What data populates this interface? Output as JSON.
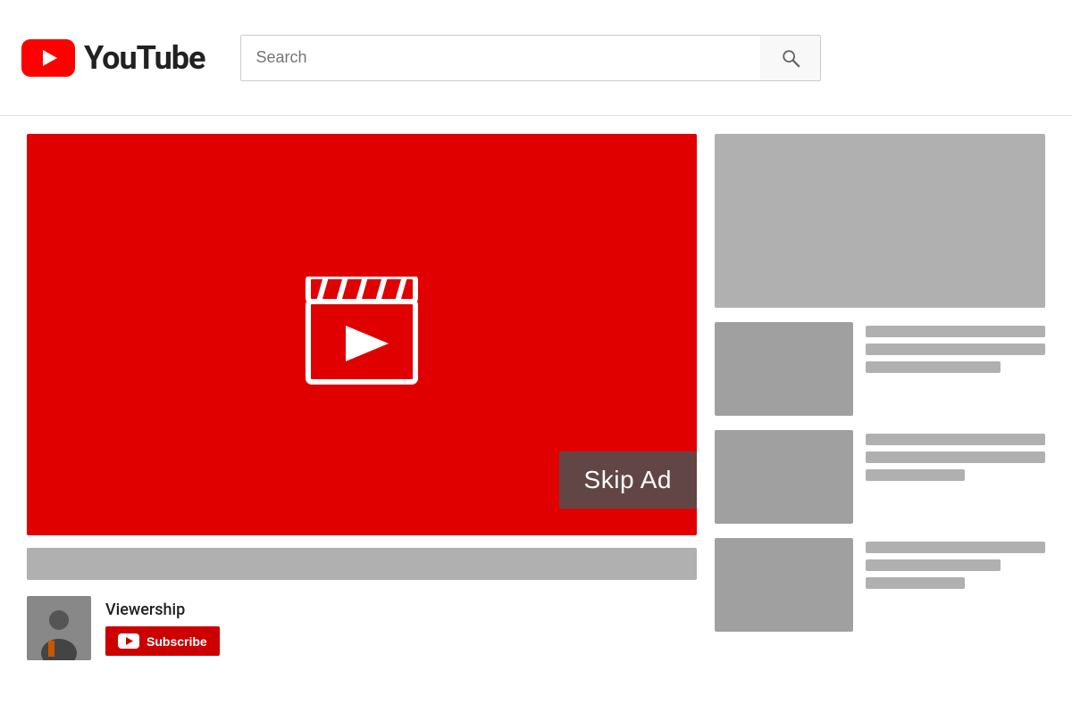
{
  "header": {
    "logo_text": "YouTube",
    "search_placeholder": "Search",
    "search_button_label": "Search"
  },
  "player": {
    "skip_ad_label": "Skip Ad",
    "channel_name": "Viewership",
    "subscribe_label": "Subscribe"
  },
  "sidebar": {
    "ad_banner_alt": "Advertisement banner",
    "video_cards": [
      {
        "id": 1
      },
      {
        "id": 2
      },
      {
        "id": 3
      }
    ]
  }
}
